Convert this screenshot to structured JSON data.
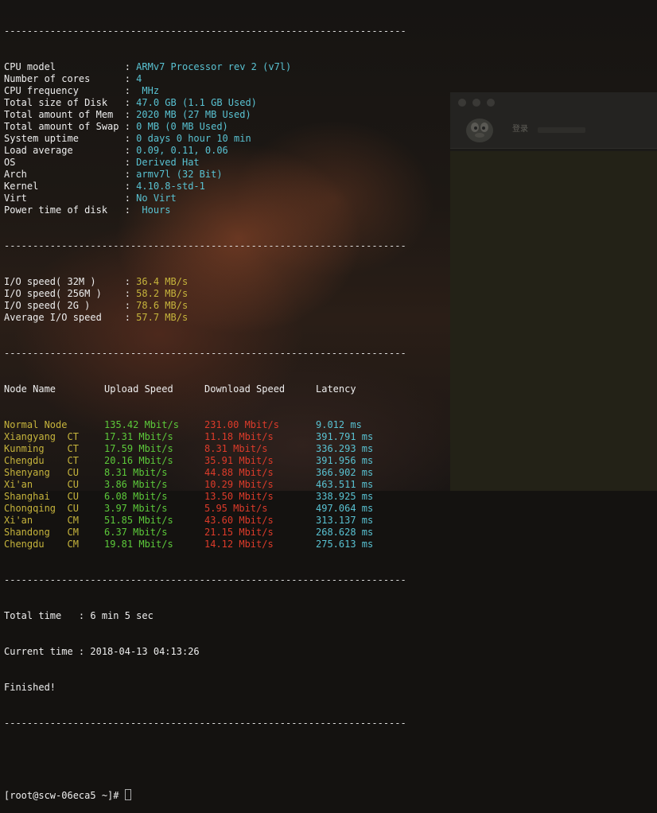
{
  "separator": "----------------------------------------------------------------------",
  "system": [
    {
      "label": "CPU model            ",
      "value": "ARMv7 Processor rev 2 (v7l)"
    },
    {
      "label": "Number of cores      ",
      "value": "4"
    },
    {
      "label": "CPU frequency        ",
      "value": " MHz"
    },
    {
      "label": "Total size of Disk   ",
      "value": "47.0 GB (1.1 GB Used)"
    },
    {
      "label": "Total amount of Mem  ",
      "value": "2020 MB (27 MB Used)"
    },
    {
      "label": "Total amount of Swap ",
      "value": "0 MB (0 MB Used)"
    },
    {
      "label": "System uptime        ",
      "value": "0 days 0 hour 10 min"
    },
    {
      "label": "Load average         ",
      "value": "0.09, 0.11, 0.06"
    },
    {
      "label": "OS                   ",
      "value": "Derived Hat"
    },
    {
      "label": "Arch                 ",
      "value": "armv7l (32 Bit)"
    },
    {
      "label": "Kernel               ",
      "value": "4.10.8-std-1"
    },
    {
      "label": "Virt                 ",
      "value": "No Virt"
    },
    {
      "label": "Power time of disk   ",
      "value": " Hours"
    }
  ],
  "io": [
    {
      "label": "I/O speed( 32M )     ",
      "value": "36.4 MB/s"
    },
    {
      "label": "I/O speed( 256M )    ",
      "value": "58.2 MB/s"
    },
    {
      "label": "I/O speed( 2G )      ",
      "value": "78.6 MB/s"
    },
    {
      "label": "Average I/O speed    ",
      "value": "57.7 MB/s"
    }
  ],
  "speedtest": {
    "headers": {
      "node": "Node Name",
      "upload": "Upload Speed",
      "download": "Download Speed",
      "latency": "Latency"
    },
    "rows": [
      {
        "node": "Normal Node",
        "upload": "135.42 Mbit/s",
        "download": "231.00 Mbit/s",
        "latency": "9.012 ms"
      },
      {
        "node": "Xiangyang  CT",
        "upload": "17.31 Mbit/s",
        "download": "11.18 Mbit/s",
        "latency": "391.791 ms"
      },
      {
        "node": "Kunming    CT",
        "upload": "17.59 Mbit/s",
        "download": "8.31 Mbit/s",
        "latency": "336.293 ms"
      },
      {
        "node": "Chengdu    CT",
        "upload": "20.16 Mbit/s",
        "download": "35.91 Mbit/s",
        "latency": "391.956 ms"
      },
      {
        "node": "Shenyang   CU",
        "upload": "8.31 Mbit/s",
        "download": "44.88 Mbit/s",
        "latency": "366.902 ms"
      },
      {
        "node": "Xi'an      CU",
        "upload": "3.86 Mbit/s",
        "download": "10.29 Mbit/s",
        "latency": "463.511 ms"
      },
      {
        "node": "Shanghai   CU",
        "upload": "6.08 Mbit/s",
        "download": "13.50 Mbit/s",
        "latency": "338.925 ms"
      },
      {
        "node": "Chongqing  CU",
        "upload": "3.97 Mbit/s",
        "download": "5.95 Mbit/s",
        "latency": "497.064 ms"
      },
      {
        "node": "Xi'an      CM",
        "upload": "51.85 Mbit/s",
        "download": "43.60 Mbit/s",
        "latency": "313.137 ms"
      },
      {
        "node": "Shandong   CM",
        "upload": "6.37 Mbit/s",
        "download": "21.15 Mbit/s",
        "latency": "268.628 ms"
      },
      {
        "node": "Chengdu    CM",
        "upload": "19.81 Mbit/s",
        "download": "14.12 Mbit/s",
        "latency": "275.613 ms"
      }
    ]
  },
  "summary": {
    "total_time_label": "Total time   ",
    "total_time_value": "6 min 5 sec",
    "current_time_label": "Current time ",
    "current_time_value": "2018-04-13 04:13:26",
    "finished": "Finished!"
  },
  "prompt": "[root@scw-06eca5 ~]# ",
  "background_window": {
    "title_fragment": "登录"
  },
  "colors": {
    "label": "#eeeeee",
    "value_cyan": "#59c2d2",
    "value_yellow": "#c6b43c",
    "value_green": "#5cc93a",
    "value_red": "#dd3b2a"
  }
}
